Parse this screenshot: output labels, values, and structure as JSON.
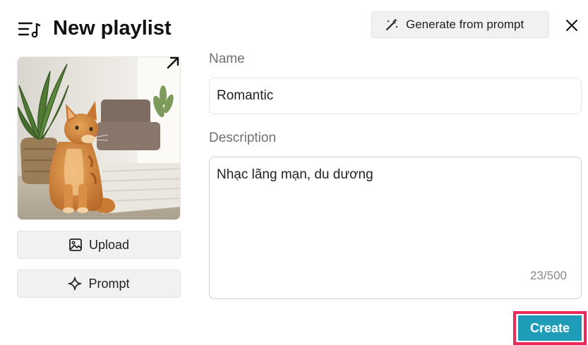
{
  "header": {
    "title": "New playlist",
    "icon": "playlist-icon",
    "generate_label": "Generate from prompt",
    "generate_icon": "magic-wand-icon",
    "close_icon": "close-icon"
  },
  "cover": {
    "image": "cat-photo",
    "edit_icon": "expand-arrow-icon",
    "upload_label": "Upload",
    "upload_icon": "image-icon",
    "prompt_label": "Prompt",
    "prompt_icon": "sparkle-icon"
  },
  "form": {
    "name_label": "Name",
    "name_value": "Romantic",
    "description_label": "Description",
    "description_value": "Nhạc lãng mạn, du dương",
    "char_count": "23/500"
  },
  "footer": {
    "create_label": "Create"
  },
  "colors": {
    "create_button": "#1e9cb8",
    "highlight_outline": "#e8295a",
    "label_gray": "#707070"
  }
}
